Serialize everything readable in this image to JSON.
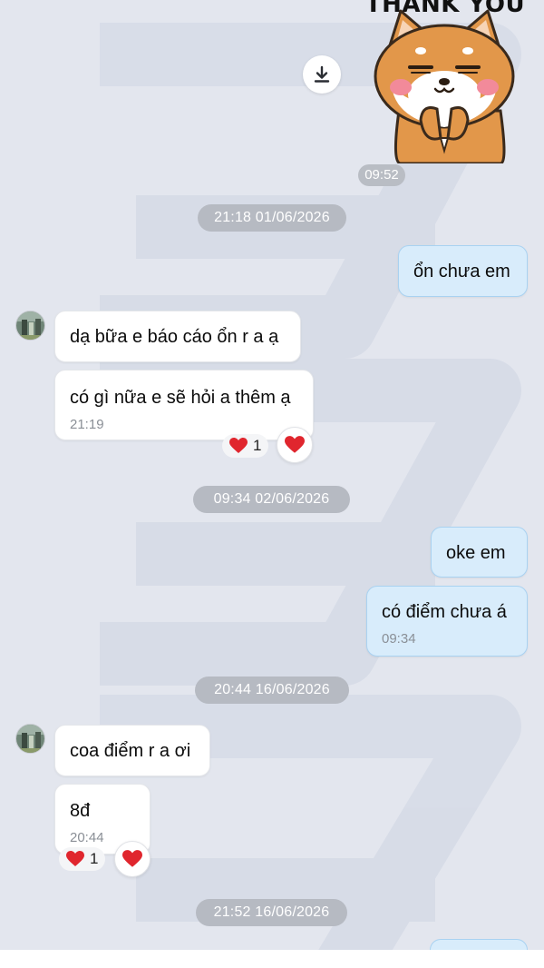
{
  "sticker": {
    "caption": "THANK YOU",
    "time": "09:52"
  },
  "date_separators": [
    "21:18 01/06/2026",
    "09:34 02/06/2026",
    "20:44 16/06/2026",
    "21:52 16/06/2026"
  ],
  "messages": [
    {
      "text": "ổn chưa em",
      "direction": "outgoing"
    },
    {
      "text": "dạ bữa e báo cáo ổn r a ạ",
      "direction": "incoming"
    },
    {
      "text": "có gì nữa e sẽ hỏi a thêm ạ",
      "time": "21:19",
      "direction": "incoming",
      "reaction_count": "1"
    },
    {
      "text": "oke em",
      "direction": "outgoing"
    },
    {
      "text": "có điểm chưa á",
      "time": "09:34",
      "direction": "outgoing"
    },
    {
      "text": "coa điểm r a ơi",
      "direction": "incoming"
    },
    {
      "text": "8đ",
      "time": "20:44",
      "direction": "incoming",
      "reaction_count": "1"
    }
  ],
  "icons": {
    "download": "download-icon",
    "heart": "heart-icon",
    "avatar": "avatar"
  },
  "colors": {
    "background": "#e3e6ee",
    "outgoing_bubble": "#d8ecfb",
    "outgoing_border": "#a9d2f1",
    "incoming_bubble": "#ffffff",
    "date_pill": "#b6bac2",
    "heart": "#e0262e"
  }
}
